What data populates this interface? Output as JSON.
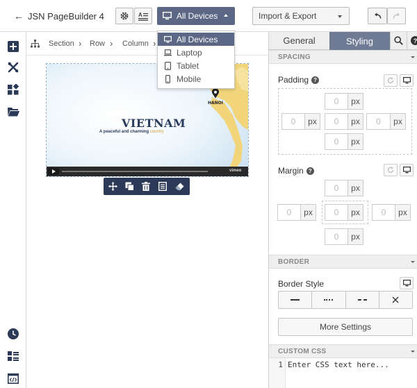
{
  "app": {
    "back_arrow": "←",
    "title": "JSN PageBuilder 4"
  },
  "header": {
    "device_select": {
      "label": "All Devices",
      "icon": "desktop-icon"
    },
    "import_export_label": "Import & Export",
    "undo_icon": "undo-icon",
    "redo_icon": "redo-icon"
  },
  "device_menu": {
    "items": [
      {
        "label": "All Devices",
        "icon": "desktop-icon",
        "selected": true
      },
      {
        "label": "Laptop",
        "icon": "laptop-icon",
        "selected": false
      },
      {
        "label": "Tablet",
        "icon": "tablet-icon",
        "selected": false
      },
      {
        "label": "Mobile",
        "icon": "mobile-icon",
        "selected": false
      }
    ]
  },
  "breadcrumb": {
    "items": [
      "Section",
      "Row",
      "Column"
    ],
    "separator": "›"
  },
  "preview": {
    "heading": "VIETNAM",
    "subheading_bold": "A peaceful and charming",
    "subheading_rest": "country",
    "pin_label": "HANOI",
    "vimeo_label": "vimeo"
  },
  "panel": {
    "tabs": [
      {
        "label": "General",
        "active": false
      },
      {
        "label": "Styling",
        "active": true
      }
    ],
    "spacing_header": "SPACING",
    "padding_label": "Padding",
    "margin_label": "Margin",
    "padding": {
      "top": "0",
      "left": "0",
      "center": "0",
      "right": "0",
      "bottom": "0",
      "unit": "px"
    },
    "margin": {
      "top": "0",
      "left": "0",
      "center": "0",
      "right": "0",
      "bottom": "0",
      "unit": "px"
    },
    "border_header": "BORDER",
    "border_style_label": "Border Style",
    "more_settings_label": "More Settings",
    "custom_css_header": "CUSTOM CSS",
    "css_line_number": "1",
    "css_placeholder": "Enter CSS text here..."
  },
  "colors": {
    "accent": "#5b6784",
    "tab_active": "#6f7b94",
    "preview_land": "#f2d57a",
    "preview_sea": "#dfeef8",
    "preview_title": "#2a3a5c"
  }
}
